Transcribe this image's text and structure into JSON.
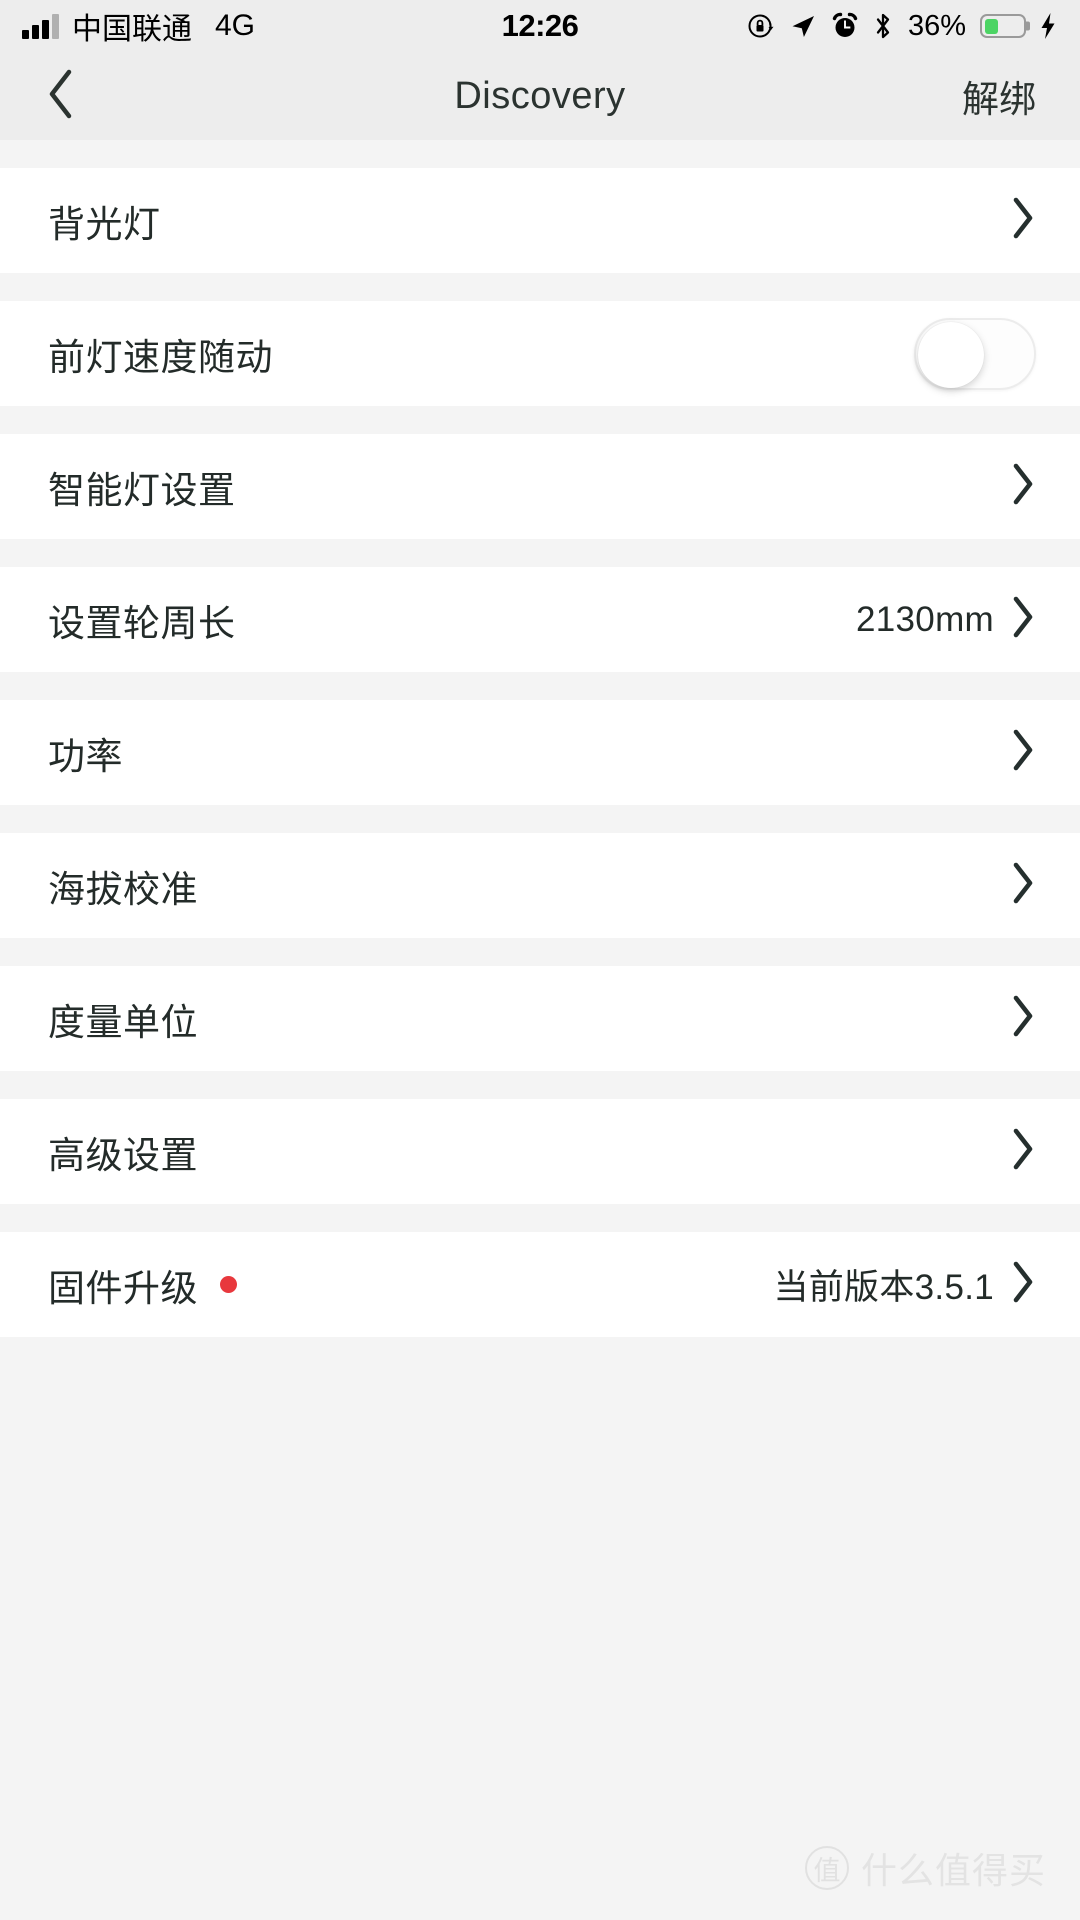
{
  "status_bar": {
    "carrier": "中国联通",
    "network_type": "4G",
    "time": "12:26",
    "battery_percent": "36%",
    "battery_level": 36,
    "battery_color": "#4cd464",
    "icons": [
      "signal-bars-icon",
      "rotation-lock-icon",
      "location-arrow-icon",
      "alarm-clock-icon",
      "bluetooth-icon",
      "battery-icon",
      "charging-bolt-icon"
    ]
  },
  "nav_bar": {
    "back_icon": "chevron-left-icon",
    "title": "Discovery",
    "action_label": "解绑"
  },
  "settings_rows": [
    {
      "label": "背光灯",
      "value": "",
      "accessory": "chevron",
      "badge": false
    },
    {
      "label": "前灯速度随动",
      "value": "",
      "accessory": "toggle",
      "badge": false,
      "toggle_on": false
    },
    {
      "label": "智能灯设置",
      "value": "",
      "accessory": "chevron",
      "badge": false
    },
    {
      "label": "设置轮周长",
      "value": "2130mm",
      "accessory": "chevron",
      "badge": false
    },
    {
      "label": "功率",
      "value": "",
      "accessory": "chevron",
      "badge": false
    },
    {
      "label": "海拔校准",
      "value": "",
      "accessory": "chevron",
      "badge": false
    },
    {
      "label": "度量单位",
      "value": "",
      "accessory": "chevron",
      "badge": false
    },
    {
      "label": "高级设置",
      "value": "",
      "accessory": "chevron",
      "badge": false
    },
    {
      "label": "固件升级",
      "value": "当前版本3.5.1",
      "accessory": "chevron",
      "badge": true
    }
  ],
  "watermark": {
    "mark": "值",
    "text": "什么值得买"
  },
  "colors": {
    "bar_background": "#ededed",
    "page_background": "#f4f4f4",
    "row_background": "#ffffff",
    "text_primary": "#232b29",
    "badge_red": "#e8383d"
  }
}
